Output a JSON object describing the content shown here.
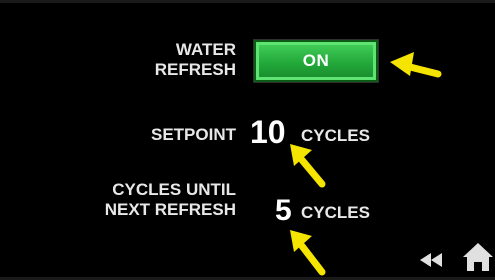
{
  "water_refresh": {
    "label": "WATER\nREFRESH",
    "toggle_value": "ON",
    "toggle_color": "#2fbf45"
  },
  "setpoint": {
    "label": "SETPOINT",
    "value": "10",
    "unit": "CYCLES"
  },
  "cycles_until": {
    "label": "CYCLES UNTIL\nNEXT REFRESH",
    "value": "5",
    "unit": "CYCLES"
  },
  "annotations": {
    "arrow_color": "#f5e400"
  },
  "nav": {
    "rewind_icon": "rewind-icon",
    "home_icon": "home-icon"
  }
}
